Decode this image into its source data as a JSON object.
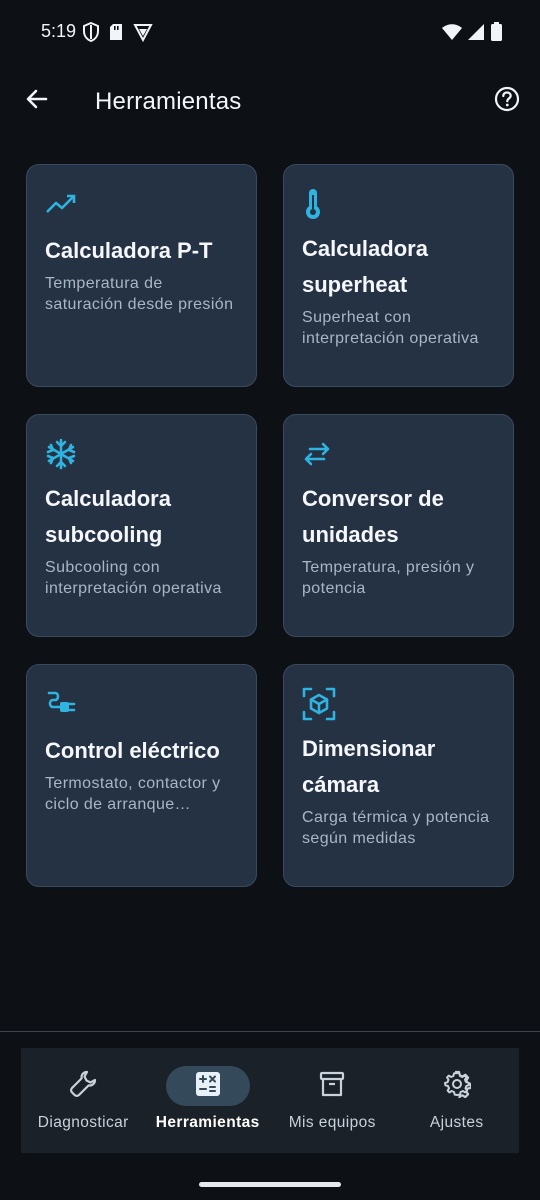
{
  "status_bar": {
    "time": "5:19"
  },
  "app_bar": {
    "title": "Herramientas"
  },
  "colors": {
    "accent": "#2fb3e0",
    "card_background": "#243243",
    "screen_background": "#0d1116"
  },
  "tools": [
    {
      "icon": "trending-up-icon",
      "title": "Calculadora P-T",
      "description": "Temperatura de saturación desde presión"
    },
    {
      "icon": "thermometer-icon",
      "title": "Calculadora superheat",
      "description": "Superheat con interpretación operativa"
    },
    {
      "icon": "snowflake-icon",
      "title": "Calculadora subcooling",
      "description": "Subcooling con interpretación operativa"
    },
    {
      "icon": "swap-arrows-icon",
      "title": "Conversor de unidades",
      "description": "Temperatura, presión y potencia"
    },
    {
      "icon": "electrical-plug-icon",
      "title": "Control eléctrico",
      "description": "Termostato, contactor y ciclo de arranque anidado"
    },
    {
      "icon": "view-in-ar-cube-icon",
      "title": "Dimensionar cámara",
      "description": "Carga térmica y potencia según medidas"
    }
  ],
  "bottom_nav": {
    "items": [
      {
        "icon": "wrench-icon",
        "label": "Diagnosticar"
      },
      {
        "icon": "calculator-icon",
        "label": "Herramientas"
      },
      {
        "icon": "archive-box-icon",
        "label": "Mis equipos"
      },
      {
        "icon": "gear-icon",
        "label": "Ajustes"
      }
    ],
    "active_index": 1
  }
}
